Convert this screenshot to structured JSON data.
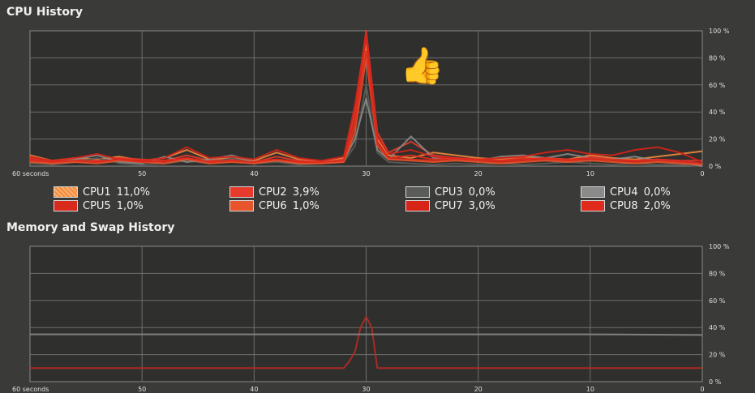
{
  "cpu_history": {
    "title": "CPU History",
    "y_ticks": [
      "100 %",
      "80 %",
      "60 %",
      "40 %",
      "20 %",
      "0 %"
    ],
    "x_ticks": [
      "60 seconds",
      "50",
      "40",
      "30",
      "20",
      "10",
      "0"
    ],
    "legend": [
      {
        "label": "CPU1",
        "value": "11,0%",
        "color": "#f08a3c",
        "pattern": "hatched"
      },
      {
        "label": "CPU2",
        "value": "3,9%",
        "color": "#e53a2c"
      },
      {
        "label": "CPU3",
        "value": "0,0%",
        "color": "#5a5c58"
      },
      {
        "label": "CPU4",
        "value": "0,0%",
        "color": "#8a8a8a"
      },
      {
        "label": "CPU5",
        "value": "1,0%",
        "color": "#d92a1e"
      },
      {
        "label": "CPU6",
        "value": "1,0%",
        "color": "#e8552a"
      },
      {
        "label": "CPU7",
        "value": "3,0%",
        "color": "#d62418"
      },
      {
        "label": "CPU8",
        "value": "2,0%",
        "color": "#e02a1c"
      }
    ]
  },
  "memory_history": {
    "title": "Memory and Swap History",
    "y_ticks": [
      "100 %",
      "80 %",
      "60 %",
      "40 %",
      "20 %",
      "0 %"
    ],
    "x_ticks": [
      "60 seconds",
      "50",
      "40",
      "30",
      "20",
      "10",
      "0"
    ]
  },
  "thumb_icon": "thumbs-up-icon",
  "chart_data": [
    {
      "type": "line",
      "title": "CPU History",
      "xlabel": "",
      "ylabel": "",
      "xlim": [
        60,
        0
      ],
      "ylim": [
        0,
        100
      ],
      "x": [
        60,
        58,
        56,
        54,
        52,
        50,
        48,
        46,
        44,
        42,
        40,
        38,
        36,
        34,
        32,
        31,
        30,
        29,
        28,
        26,
        24,
        22,
        20,
        18,
        16,
        14,
        12,
        10,
        8,
        6,
        4,
        2,
        0
      ],
      "series": [
        {
          "name": "CPU1",
          "color": "#f08a3c",
          "values": [
            8,
            4,
            6,
            5,
            7,
            4,
            6,
            12,
            5,
            6,
            4,
            10,
            5,
            3,
            6,
            30,
            90,
            20,
            8,
            6,
            10,
            8,
            6,
            5,
            7,
            6,
            5,
            8,
            6,
            5,
            7,
            9,
            11
          ]
        },
        {
          "name": "CPU2",
          "color": "#e53a2c",
          "values": [
            6,
            3,
            5,
            4,
            6,
            5,
            4,
            8,
            4,
            5,
            3,
            7,
            4,
            3,
            5,
            40,
            100,
            25,
            10,
            18,
            8,
            6,
            5,
            4,
            6,
            5,
            4,
            7,
            5,
            4,
            5,
            4,
            4
          ]
        },
        {
          "name": "CPU3",
          "color": "#5a5c58",
          "values": [
            2,
            1,
            3,
            6,
            2,
            1,
            2,
            4,
            2,
            6,
            2,
            3,
            1,
            2,
            3,
            15,
            60,
            10,
            3,
            2,
            1,
            2,
            1,
            2,
            1,
            2,
            3,
            2,
            1,
            2,
            1,
            1,
            0
          ]
        },
        {
          "name": "CPU4",
          "color": "#8a8a8a",
          "values": [
            4,
            2,
            5,
            8,
            3,
            2,
            7,
            3,
            5,
            8,
            3,
            4,
            2,
            3,
            4,
            20,
            50,
            12,
            5,
            22,
            6,
            5,
            4,
            7,
            8,
            6,
            9,
            6,
            5,
            7,
            4,
            3,
            0
          ]
        },
        {
          "name": "CPU5",
          "color": "#d92a1e",
          "values": [
            5,
            3,
            4,
            3,
            5,
            4,
            3,
            6,
            3,
            4,
            3,
            5,
            3,
            2,
            4,
            35,
            95,
            18,
            6,
            5,
            4,
            5,
            4,
            3,
            4,
            5,
            4,
            5,
            4,
            3,
            4,
            3,
            1
          ]
        },
        {
          "name": "CPU6",
          "color": "#e8552a",
          "values": [
            3,
            2,
            3,
            2,
            4,
            3,
            2,
            5,
            2,
            3,
            2,
            4,
            2,
            2,
            3,
            25,
            80,
            15,
            5,
            4,
            3,
            4,
            3,
            2,
            3,
            4,
            3,
            4,
            3,
            2,
            3,
            2,
            1
          ]
        },
        {
          "name": "CPU7",
          "color": "#d62418",
          "values": [
            7,
            4,
            6,
            9,
            5,
            4,
            6,
            14,
            6,
            7,
            5,
            12,
            6,
            4,
            7,
            45,
            98,
            22,
            9,
            12,
            7,
            6,
            5,
            6,
            7,
            10,
            12,
            9,
            8,
            12,
            14,
            10,
            3
          ]
        },
        {
          "name": "CPU8",
          "color": "#e02a1c",
          "values": [
            4,
            3,
            4,
            3,
            5,
            3,
            4,
            6,
            3,
            4,
            3,
            5,
            3,
            3,
            4,
            30,
            85,
            16,
            6,
            8,
            5,
            6,
            5,
            4,
            5,
            6,
            5,
            6,
            5,
            4,
            5,
            4,
            2
          ]
        }
      ]
    },
    {
      "type": "line",
      "title": "Memory and Swap History",
      "xlabel": "",
      "ylabel": "",
      "xlim": [
        60,
        0
      ],
      "ylim": [
        0,
        100
      ],
      "x": [
        60,
        50,
        40,
        35,
        32,
        31.5,
        31,
        30.5,
        30,
        29.5,
        29,
        28,
        20,
        10,
        0
      ],
      "series": [
        {
          "name": "",
          "color": "#b82a22",
          "values": [
            10,
            10,
            10,
            10,
            10,
            15,
            22,
            40,
            48,
            40,
            10,
            10,
            10,
            10,
            10
          ]
        },
        {
          "name": "",
          "color": "#8a8a8a",
          "values": [
            35,
            35,
            35,
            35,
            35,
            35,
            35,
            35,
            35,
            35,
            35,
            35,
            35,
            35,
            34.5
          ]
        }
      ]
    }
  ]
}
